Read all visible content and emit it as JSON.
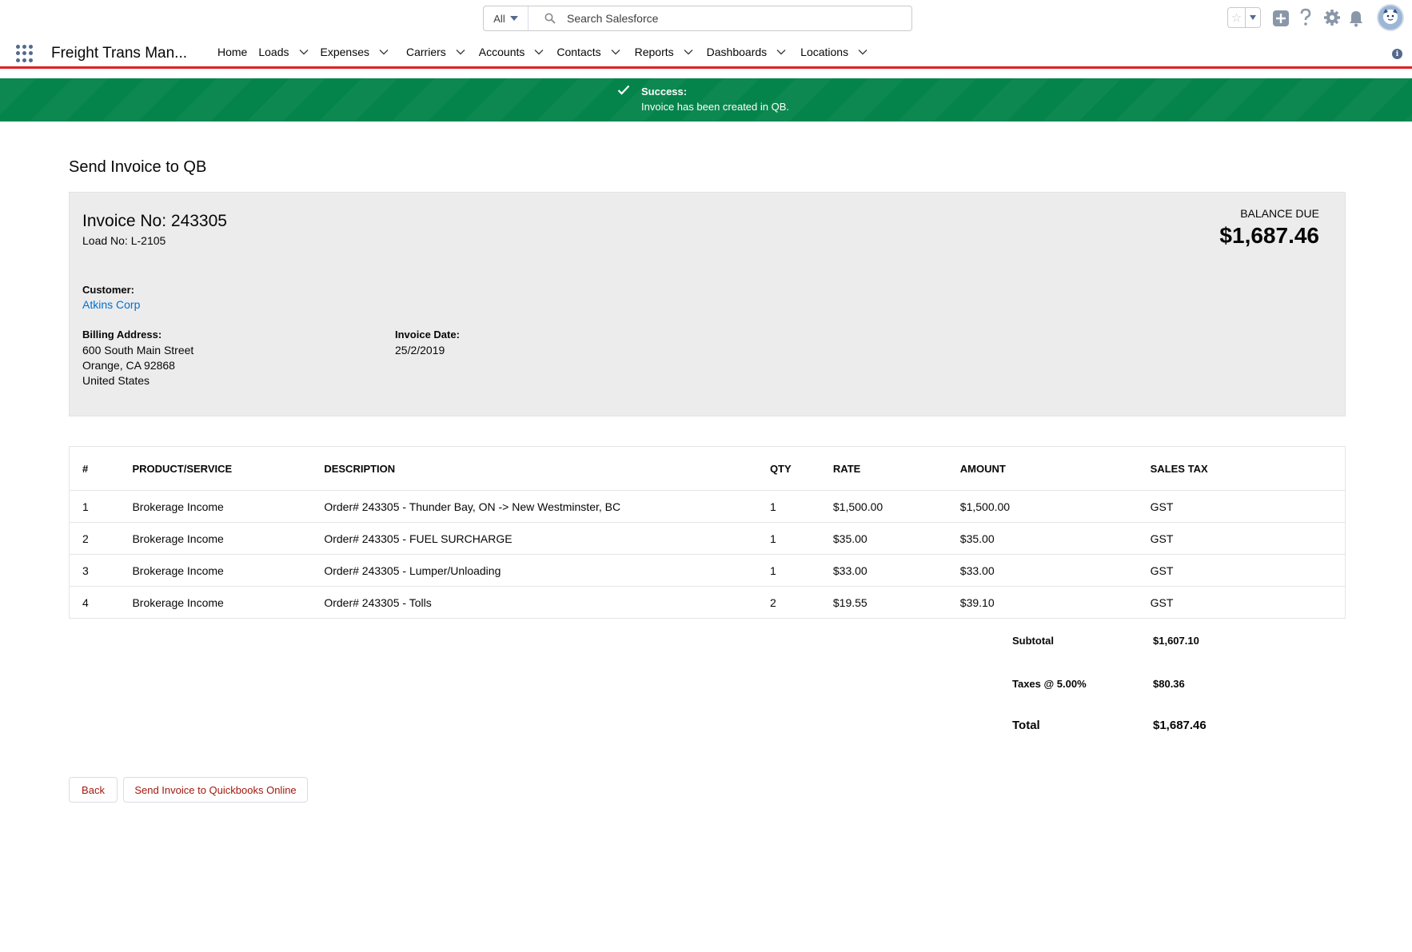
{
  "header": {
    "search_scope": "All",
    "search_placeholder": "Search Salesforce"
  },
  "nav": {
    "app_name": "Freight Trans Man...",
    "items": [
      {
        "label": "Home",
        "dropdown": false
      },
      {
        "label": "Loads",
        "dropdown": true
      },
      {
        "label": "Expenses",
        "dropdown": true
      },
      {
        "label": "Carriers",
        "dropdown": true
      },
      {
        "label": "Accounts",
        "dropdown": true
      },
      {
        "label": "Contacts",
        "dropdown": true
      },
      {
        "label": "Reports",
        "dropdown": true
      },
      {
        "label": "Dashboards",
        "dropdown": true
      },
      {
        "label": "Locations",
        "dropdown": true
      }
    ]
  },
  "toast": {
    "title": "Success:",
    "message": "Invoice has been created in QB."
  },
  "page": {
    "title": "Send Invoice to QB"
  },
  "invoice": {
    "number_label": "Invoice No: 243305",
    "load_label": "Load No: L-2105",
    "balance_due_label": "BALANCE DUE",
    "balance_due": "$1,687.46",
    "customer_label": "Customer:",
    "customer_name": "Atkins Corp",
    "billing_label": "Billing Address:",
    "billing_lines": [
      "600 South Main Street",
      "Orange, CA 92868",
      "United States"
    ],
    "date_label": "Invoice Date:",
    "date": "25/2/2019"
  },
  "table": {
    "headers": [
      "#",
      "PRODUCT/SERVICE",
      "DESCRIPTION",
      "QTY",
      "RATE",
      "AMOUNT",
      "SALES TAX"
    ],
    "rows": [
      [
        "1",
        "Brokerage Income",
        "Order# 243305 - Thunder Bay, ON -> New Westminster, BC",
        "1",
        "$1,500.00",
        "$1,500.00",
        "GST"
      ],
      [
        "2",
        "Brokerage Income",
        "Order# 243305 - FUEL SURCHARGE",
        "1",
        "$35.00",
        "$35.00",
        "GST"
      ],
      [
        "3",
        "Brokerage Income",
        "Order# 243305 - Lumper/Unloading",
        "1",
        "$33.00",
        "$33.00",
        "GST"
      ],
      [
        "4",
        "Brokerage Income",
        "Order# 243305 - Tolls",
        "2",
        "$19.55",
        "$39.10",
        "GST"
      ]
    ]
  },
  "totals": {
    "subtotal_label": "Subtotal",
    "subtotal": "$1,607.10",
    "tax_label": "Taxes @ 5.00%",
    "tax": "$80.36",
    "total_label": "Total",
    "total": "$1,687.46"
  },
  "buttons": {
    "back": "Back",
    "send": "Send Invoice to Quickbooks Online"
  },
  "colors": {
    "success": "#04844b",
    "link": "#0070d2",
    "accent_bar": "#e02020",
    "button_text": "#a2180e"
  }
}
